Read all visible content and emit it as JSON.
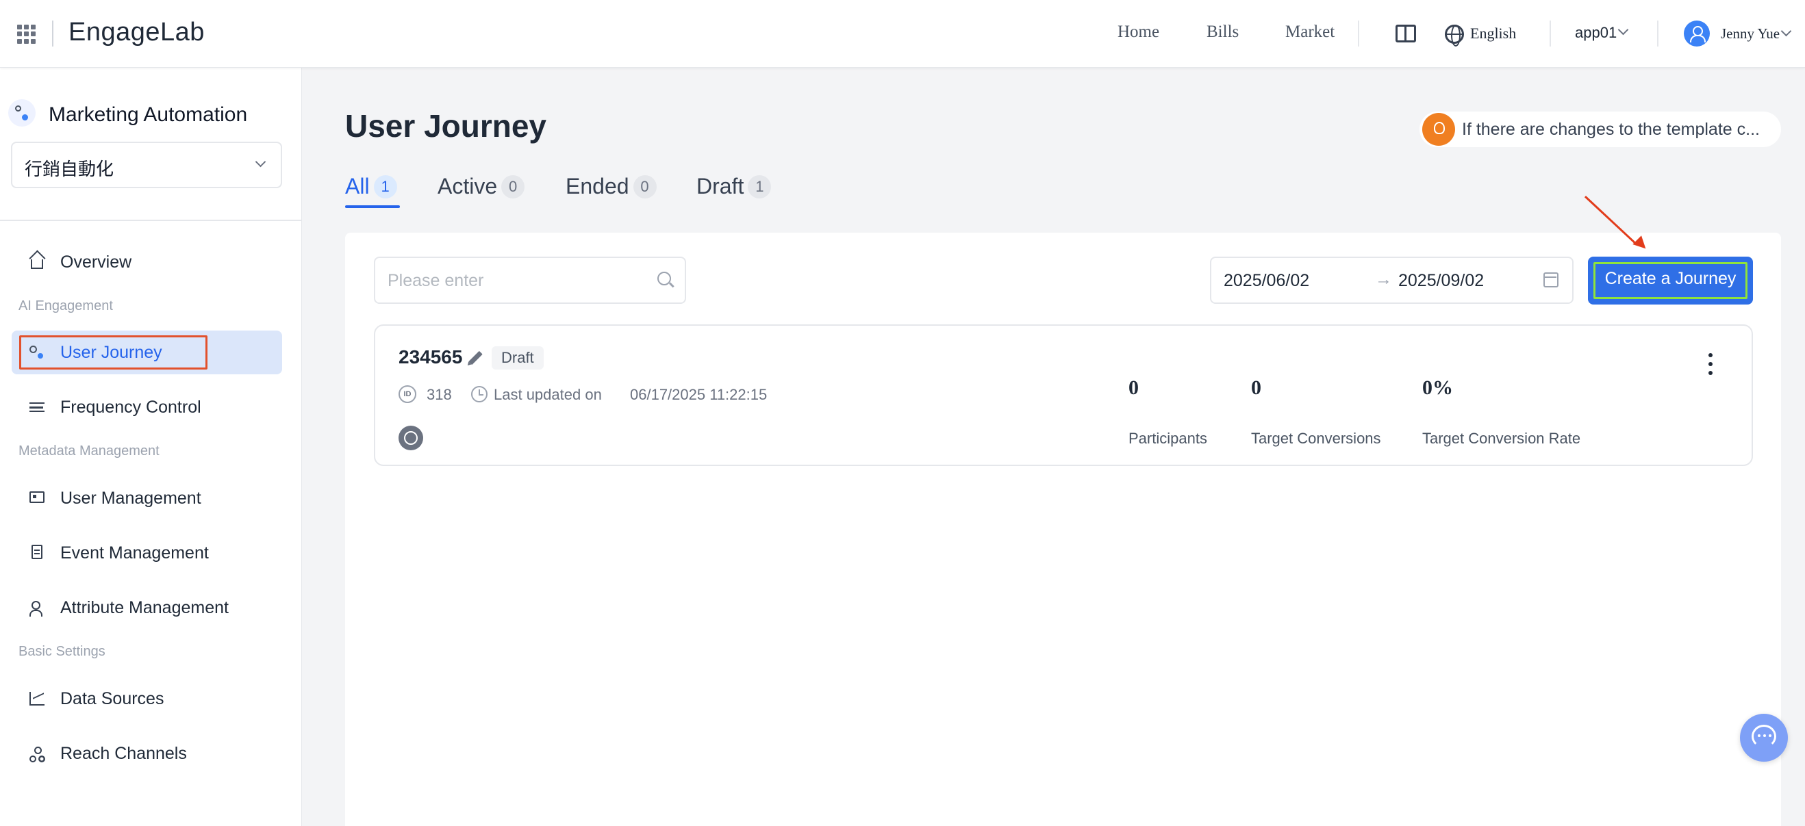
{
  "topnav": {
    "logo": "EngageLab",
    "links": [
      "Home",
      "Bills",
      "Market"
    ],
    "language": "English",
    "app": "app01",
    "user": "Jenny Yue"
  },
  "sidebar": {
    "title": "Marketing Automation",
    "workspace": "行銷自動化",
    "sections": [
      "AI Engagement",
      "Metadata Management",
      "Basic Settings"
    ],
    "items": [
      {
        "label": "Overview",
        "icon": "home-icon"
      },
      {
        "label": "User Journey",
        "icon": "flow-icon",
        "active": true
      },
      {
        "label": "Frequency Control",
        "icon": "sliders-icon"
      },
      {
        "label": "User Management",
        "icon": "id-card-icon"
      },
      {
        "label": "Event Management",
        "icon": "clipboard-icon"
      },
      {
        "label": "Attribute Management",
        "icon": "user-icon"
      },
      {
        "label": "Data Sources",
        "icon": "line-chart-icon"
      },
      {
        "label": "Reach Channels",
        "icon": "network-icon"
      }
    ]
  },
  "main": {
    "title": "User Journey",
    "notice": "If there are changes to the template c...",
    "tabs": [
      {
        "label": "All",
        "count": "1",
        "active": true
      },
      {
        "label": "Active",
        "count": "0"
      },
      {
        "label": "Ended",
        "count": "0"
      },
      {
        "label": "Draft",
        "count": "1"
      }
    ],
    "search_placeholder": "Please enter",
    "date_start": "2025/06/02",
    "date_arrow": "→",
    "date_end": "2025/09/02",
    "create_label": "Create a Journey",
    "journeys": [
      {
        "name": "234565",
        "status": "Draft",
        "id": "318",
        "updated_label": "Last updated on",
        "updated_at": "06/17/2025 11:22:15",
        "channel_icon": "whatsapp-icon",
        "metrics": [
          {
            "value": "0",
            "label": "Participants"
          },
          {
            "value": "0",
            "label": "Target Conversions"
          },
          {
            "value": "0%",
            "label": "Target Conversion Rate"
          }
        ]
      }
    ]
  },
  "colors": {
    "accent": "#2f6fe6",
    "highlight_red": "#e2512c",
    "highlight_green": "#8fe33a",
    "notice_orange": "#f07f21"
  }
}
